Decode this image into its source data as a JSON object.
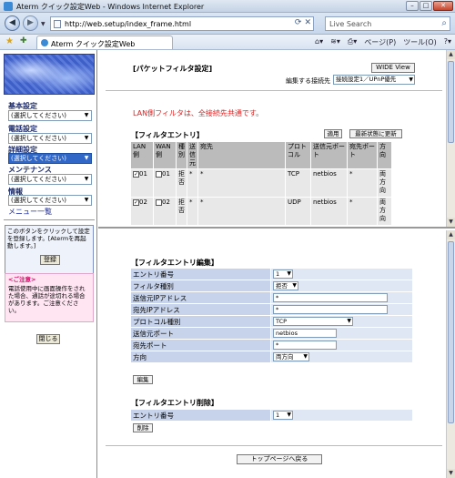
{
  "window": {
    "title": "Aterm クイック設定Web - Windows Internet Explorer",
    "url": "http://web.setup/index_frame.html",
    "search_placeholder": "Live Search",
    "tab_label": "Aterm クイック設定Web",
    "tools": {
      "page": "ページ(P)",
      "tools": "ツール(O)"
    }
  },
  "sidebar": {
    "groups": [
      {
        "label": "基本設定",
        "value": "(選択してください)"
      },
      {
        "label": "電話設定",
        "value": "(選択してください)"
      },
      {
        "label": "詳細設定",
        "value": "(選択してください)"
      },
      {
        "label": "メンテナンス",
        "value": "(選択してください)"
      },
      {
        "label": "情報",
        "value": "(選択してください)"
      }
    ],
    "menu_list_link": "メニュー一覧",
    "hint_text": "このボタンをクリックして設定を登録します。[Atermを再起動します。]",
    "register_label": "登録",
    "caution_title": "<ご注意>",
    "caution_text": "電話使用中に画面操作をされた場合、通話が途切れる場合があります。ご注意ください。",
    "close_label": "閉じる"
  },
  "top": {
    "title": "[パケットフィルタ設定]",
    "wide_view_label": "WIDE View",
    "connection_label": "編集する接続先",
    "connection_value": "接続設定1／UPnP優先",
    "note": "LAN側フィルタは、全接続先共通です。",
    "entries_title": "【フィルタエントリ】",
    "apply_label": "適用",
    "refresh_label": "最新状態に更新",
    "columns": [
      "LAN側",
      "WAN側",
      "種別",
      "送信元",
      "宛先",
      "プロトコル",
      "送信元ポート",
      "宛先ポート",
      "方向"
    ],
    "rows": [
      {
        "lan": "01",
        "wan": "01",
        "type": "拒否",
        "src": "*",
        "dst": "*",
        "protocol": "TCP",
        "src_port": "netbios",
        "dst_port": "*",
        "dir": "両方向",
        "lan_checked": true,
        "wan_checked": false
      },
      {
        "lan": "02",
        "wan": "02",
        "type": "拒否",
        "src": "*",
        "dst": "*",
        "protocol": "UDP",
        "src_port": "netbios",
        "dst_port": "*",
        "dir": "両方向",
        "lan_checked": true,
        "wan_checked": false
      }
    ]
  },
  "edit": {
    "title": "【フィルタエントリ編集】",
    "fields": [
      {
        "label": "エントリ番号",
        "value": "1"
      },
      {
        "label": "フィルタ種別",
        "value": "拒否"
      },
      {
        "label": "送信元IPアドレス",
        "value": "*"
      },
      {
        "label": "宛先IPアドレス",
        "value": "*"
      },
      {
        "label": "プロトコル種別",
        "value": "TCP"
      },
      {
        "label": "送信元ポート",
        "value": "netbios"
      },
      {
        "label": "宛先ポート",
        "value": "*"
      },
      {
        "label": "方向",
        "value": "両方向"
      }
    ],
    "edit_button": "編集",
    "delete_title": "【フィルタエントリ削除】",
    "delete_field_label": "エントリ番号",
    "delete_field_value": "1",
    "delete_button": "削除",
    "back_button": "トップページへ戻る"
  }
}
